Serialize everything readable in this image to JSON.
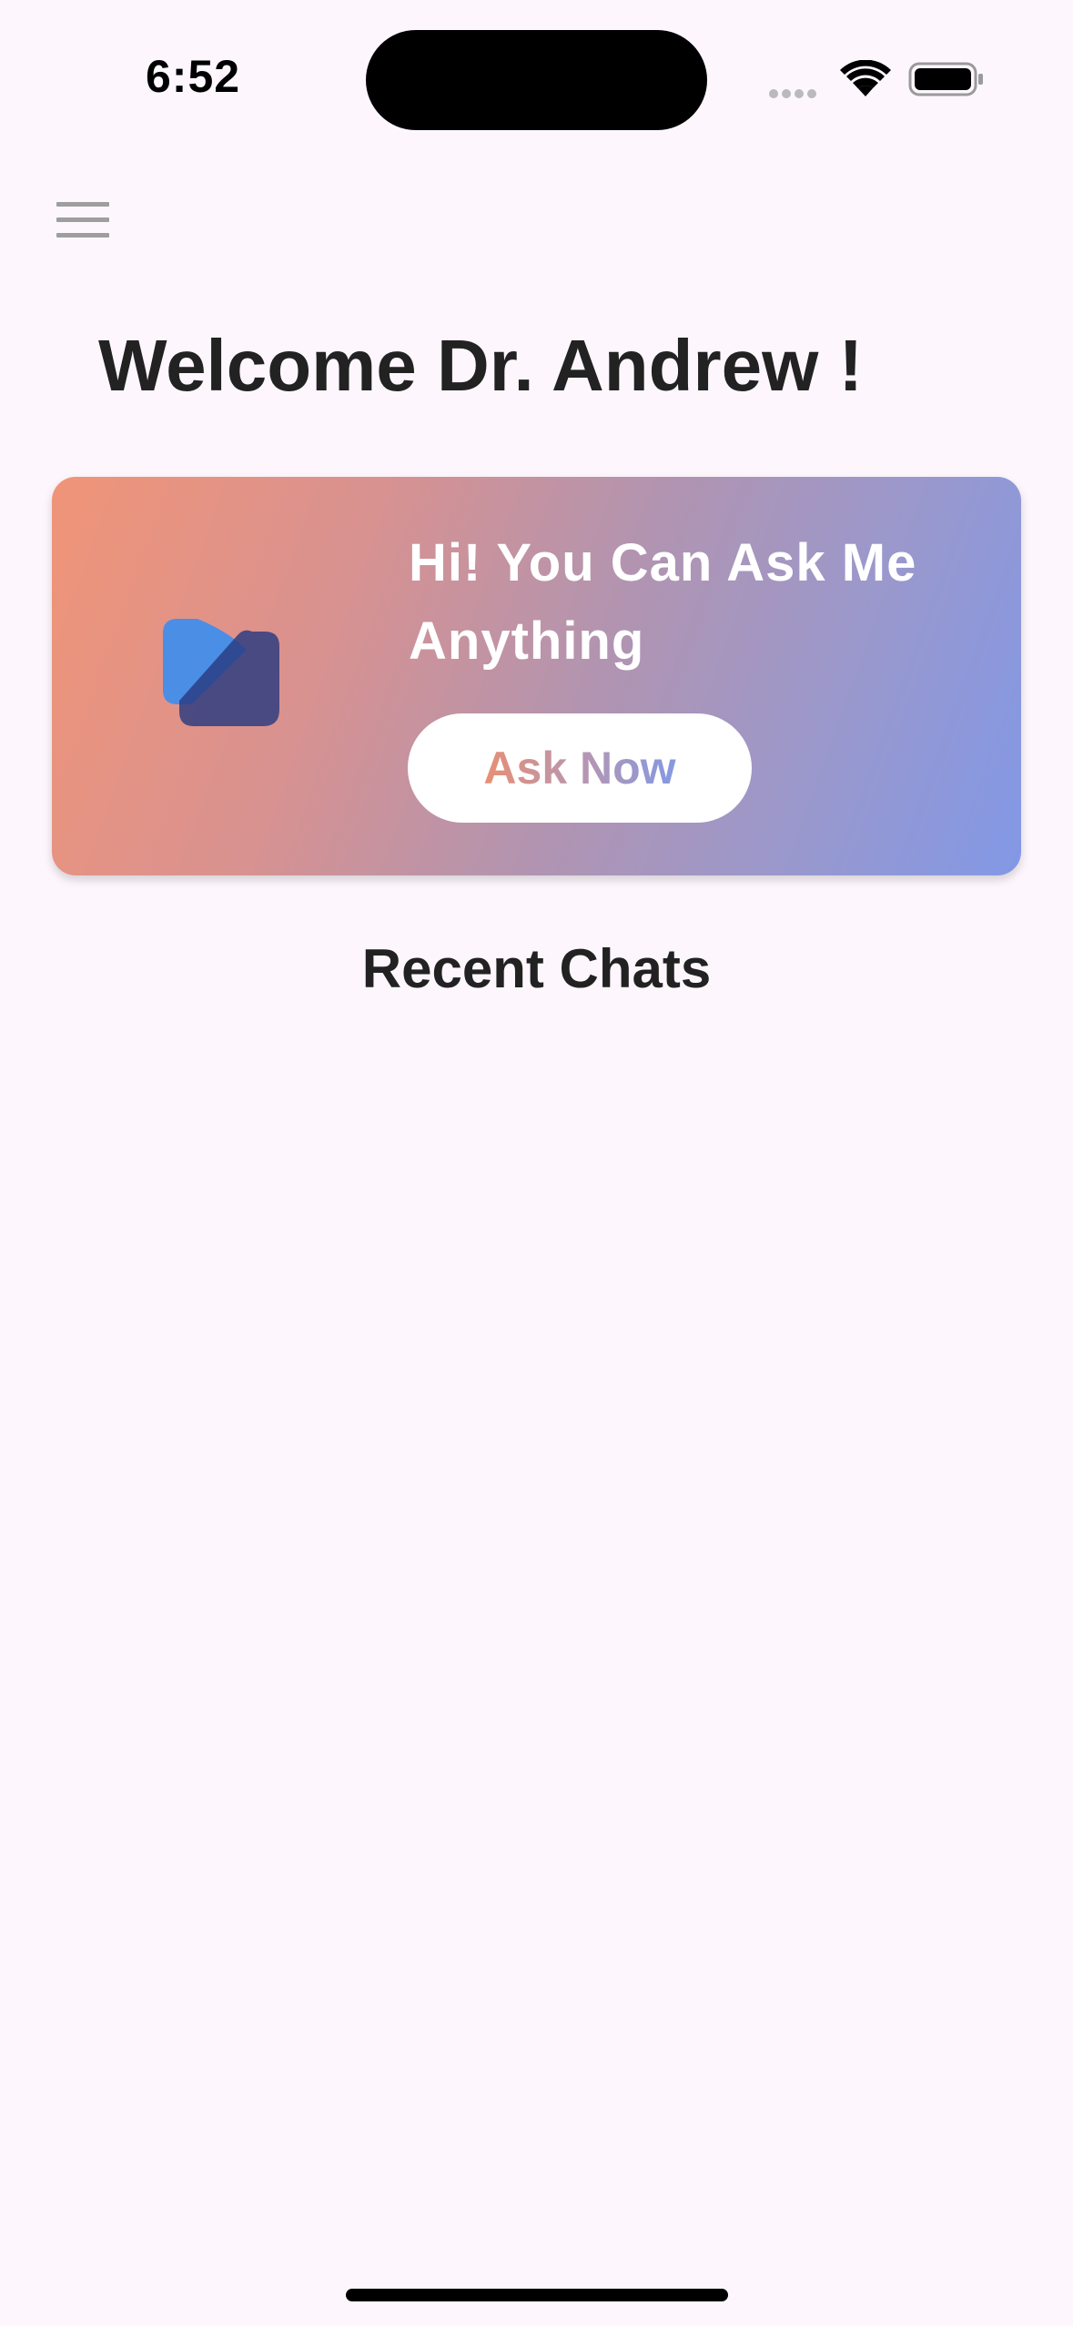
{
  "status_bar": {
    "time": "6:52",
    "icons": [
      "signal-icon",
      "wifi-icon",
      "battery-icon"
    ]
  },
  "header": {
    "menu_icon": "hamburger-menu-icon",
    "welcome": "Welcome Dr. Andrew !"
  },
  "ask_card": {
    "logo_icon": "assistant-logo-icon",
    "heading": "Hi! You Can Ask Me Anything",
    "button_label": "Ask Now",
    "gradient_start": "#f09478",
    "gradient_end": "#8298e6"
  },
  "recent_chats": {
    "title": "Recent Chats",
    "items": []
  },
  "colors": {
    "background": "#fdf7fd",
    "text": "#222222",
    "logo_light": "#4a8ee6",
    "logo_dark": "#2a3a80"
  }
}
